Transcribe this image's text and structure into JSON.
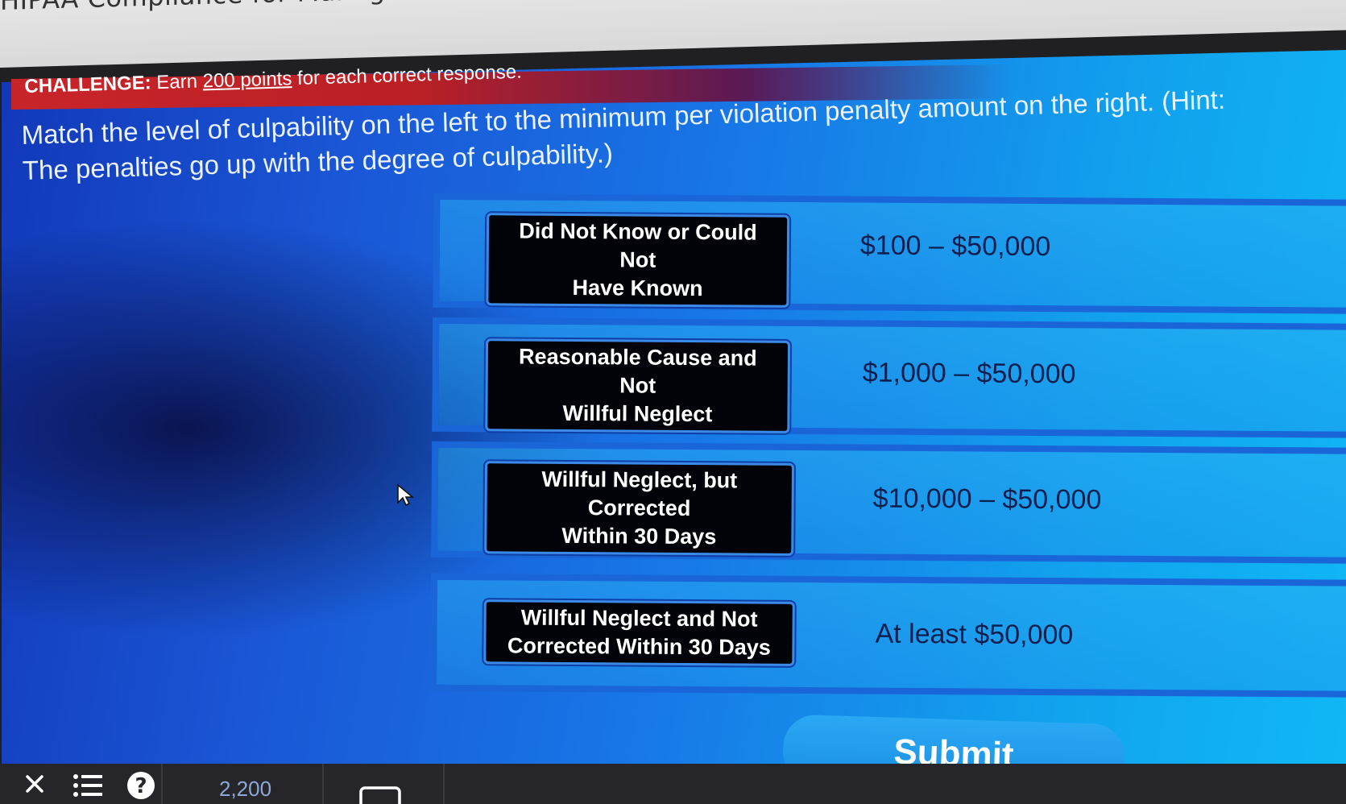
{
  "window": {
    "course_title": "HIPAA Compliance for Manage"
  },
  "challenge": {
    "label": "CHALLENGE:",
    "text_before": " Earn ",
    "points_link": "200 points",
    "text_after": " for each correct response."
  },
  "instruction": "Match the level of culpability on the left to the minimum per violation penalty amount on the right.  (Hint: The penalties go up with the degree of culpability.)",
  "matches": [
    {
      "label_line1": "Did Not Know or Could Not",
      "label_line2": "Have Known",
      "amount": "$100 – $50,000"
    },
    {
      "label_line1": "Reasonable Cause and Not",
      "label_line2": "Willful Neglect",
      "amount": "$1,000 – $50,000"
    },
    {
      "label_line1": "Willful Neglect, but Corrected",
      "label_line2": "Within 30 Days",
      "amount": "$10,000 – $50,000"
    },
    {
      "label_line1": "Willful Neglect and Not",
      "label_line2": "Corrected Within 30 Days",
      "amount": "At least $50,000"
    }
  ],
  "submit_label": "Submit",
  "bottom_bar": {
    "icons": [
      "close-icon",
      "menu-list-icon",
      "help-icon",
      "captions-icon"
    ],
    "score": "2,200"
  }
}
